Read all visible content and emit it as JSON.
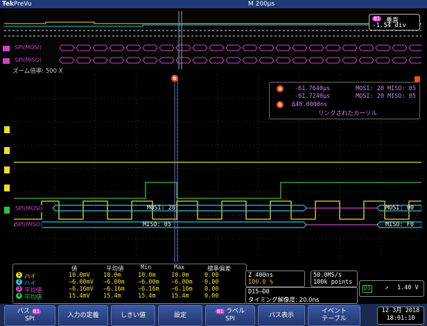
{
  "title_bar": {
    "brand": "Tek",
    "mode": "PreVu",
    "timebase": "M 200μs"
  },
  "overview": {
    "bus1_label": "SPI(MOSI)",
    "bus2_label": "SPI(MISO)",
    "vertical_title": "垂直",
    "vertical_value": "-1.54 div",
    "b1_badge": "B1"
  },
  "zoom_label": "ズーム倍率: 500 X",
  "cursor_marker": "b",
  "cursor_readout": {
    "a_time": "-61.7640μs",
    "a_bus": "MOSI: 20 MISO: 05",
    "b_time": "-61.7240μs",
    "b_bus": "MOSI: 20 MISO: 05",
    "delta": "Δ40.0000ns",
    "linked": "リンクされたカーソル",
    "a_icon": "a",
    "b_icon": "b"
  },
  "buses": {
    "mosi_label": "SPI(MOSI)",
    "mosi_value": "MOSI: 20",
    "mosi_next": "MOSI: 00",
    "miso_label": "SPI(MISO)",
    "miso_value": "MISO: 05",
    "miso_next": "MISO: F0"
  },
  "measurements": {
    "headers": [
      "値",
      "平均値",
      "Min",
      "Max",
      "標準偏差"
    ],
    "rows": [
      {
        "chip": "1",
        "name": "ハイ",
        "color": "#f0e020",
        "values": [
          "10.0mV",
          "10.0m",
          "10.0m",
          "10.0m",
          "0.00"
        ]
      },
      {
        "chip": "2",
        "name": "ハイ",
        "color": "#22c8e8",
        "values": [
          "−6.00mV",
          "−6.00m",
          "−6.00m",
          "−6.00m",
          "0.00"
        ]
      },
      {
        "chip": "3",
        "name": "平均値",
        "color": "#d040c8",
        "values": [
          "−6.16mV",
          "−6.16m",
          "−6.16m",
          "−6.16m",
          "0.00"
        ]
      },
      {
        "chip": "4",
        "name": "平均値",
        "color": "#30c040",
        "values": [
          "15.4mV",
          "15.4m",
          "15.4m",
          "15.4m",
          "0.00"
        ]
      }
    ]
  },
  "horizontal": {
    "scale": "Z 400ns",
    "position": "100.0 %"
  },
  "acquisition": {
    "rate": "50.0MS/s",
    "points": "100k points"
  },
  "digital": {
    "channels": "D15–D0",
    "timing": "タイミング解像度: 20.0ns"
  },
  "trigger": {
    "source": "D5",
    "slope": "↗",
    "level": "1.40 V"
  },
  "softkeys": [
    {
      "line1": "バス",
      "badge": "B1",
      "line2": "SPI"
    },
    {
      "line1": "入力の定義",
      "line2": ""
    },
    {
      "line1": "しきい値",
      "line2": ""
    },
    {
      "line1": "設定",
      "line2": ""
    },
    {
      "badge": "B1",
      "line1": "ラベル",
      "line2": "SPI"
    },
    {
      "line1": "バス表示",
      "line2": ""
    },
    {
      "line1": "イベント",
      "line2": "テーブル"
    }
  ],
  "clock": {
    "date": "12 3月 2018",
    "time": "18:01:10"
  },
  "channel_markers": [
    "B1",
    "B2",
    "1",
    "2",
    "3",
    "4",
    "T"
  ],
  "colors": {
    "ch1": "#f0e020",
    "ch2": "#22c8e8",
    "ch3": "#d040c8",
    "ch4": "#30c040",
    "bus": "#cc44cc",
    "cursor": "#e8541c",
    "grid": "#444444"
  }
}
